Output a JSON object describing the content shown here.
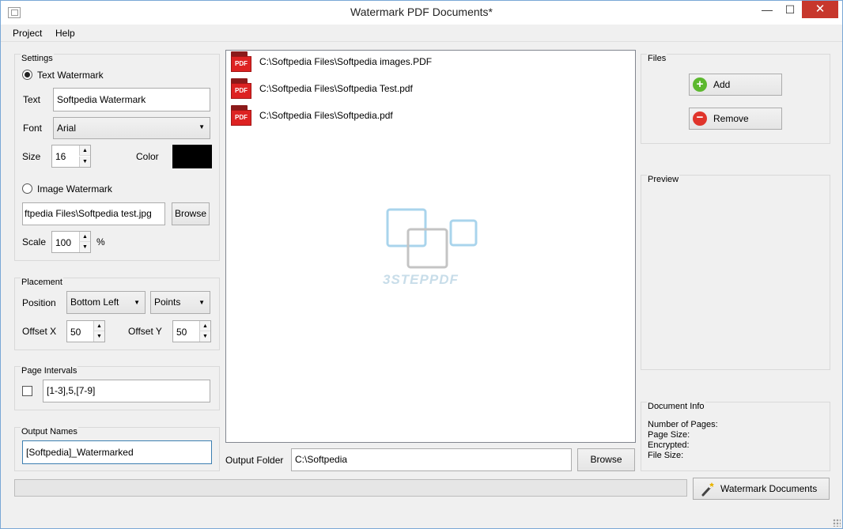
{
  "window": {
    "title": "Watermark PDF Documents*",
    "min_glyph": "—",
    "max_glyph": "☐",
    "close_glyph": "✕"
  },
  "menu": [
    "Project",
    "Help"
  ],
  "settings": {
    "title": "Settings",
    "text_watermark_label": "Text Watermark",
    "text_label": "Text",
    "text_value": "Softpedia Watermark",
    "font_label": "Font",
    "font_value": "Arial",
    "size_label": "Size",
    "size_value": "16",
    "color_label": "Color",
    "color_value": "#000000",
    "image_watermark_label": "Image Watermark",
    "image_path": "ftpedia Files\\Softpedia test.jpg",
    "browse_label": "Browse",
    "scale_label": "Scale",
    "scale_value": "100",
    "scale_unit": "%"
  },
  "placement": {
    "title": "Placement",
    "position_label": "Position",
    "position_value": "Bottom Left",
    "unit_value": "Points",
    "offset_x_label": "Offset X",
    "offset_x_value": "50",
    "offset_y_label": "Offset Y",
    "offset_y_value": "50"
  },
  "page_intervals": {
    "title": "Page Intervals",
    "value": "[1-3],5,[7-9]"
  },
  "output_names": {
    "title": "Output Names",
    "value": "[Softpedia]_Watermarked"
  },
  "files_list": [
    {
      "name": "C:\\Softpedia Files\\Softpedia images.PDF",
      "icon_text": "PDF"
    },
    {
      "name": "C:\\Softpedia Files\\Softpedia Test.pdf",
      "icon_text": "PDF"
    },
    {
      "name": "C:\\Softpedia Files\\Softpedia.pdf",
      "icon_text": "PDF"
    }
  ],
  "logo_text": "3STEPPDF",
  "output_folder": {
    "label": "Output Folder",
    "value": "C:\\Softpedia",
    "browse_label": "Browse"
  },
  "files_panel": {
    "title": "Files",
    "add_label": "Add",
    "remove_label": "Remove"
  },
  "preview": {
    "title": "Preview"
  },
  "document_info": {
    "title": "Document Info",
    "lines": [
      "Number of Pages:",
      "Page Size:",
      "Encrypted:",
      "File Size:"
    ]
  },
  "watermark_button_label": "Watermark Documents",
  "colors": {
    "accent_green": "#5cb82e",
    "accent_red": "#e0342b",
    "title_close": "#c7372c",
    "logo_blue": "#a9d4ec"
  }
}
